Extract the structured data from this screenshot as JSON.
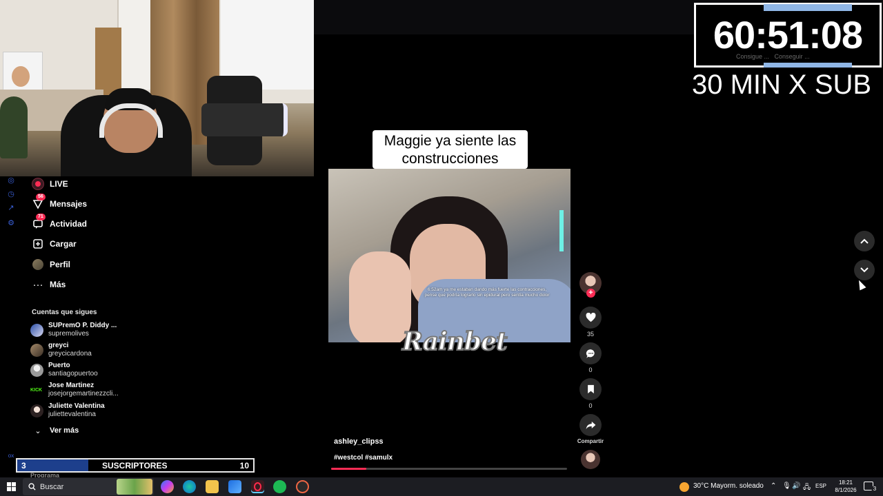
{
  "timer": {
    "value": "60:51:08",
    "ghost_left": "Consigue ...",
    "ghost_right": "Conseguir ...",
    "rate": "30 MIN X SUB"
  },
  "sidebar": {
    "items": [
      {
        "label": "LIVE",
        "icon": "live-icon"
      },
      {
        "label": "Mensajes",
        "icon": "messages-icon",
        "badge": "56"
      },
      {
        "label": "Actividad",
        "icon": "activity-icon",
        "badge": "71"
      },
      {
        "label": "Cargar",
        "icon": "upload-icon"
      },
      {
        "label": "Perfil",
        "icon": "profile-avatar"
      },
      {
        "label": "Más",
        "icon": "more-icon"
      }
    ],
    "following_title": "Cuentas que sigues",
    "following": [
      {
        "name": "SUPremO P. Diddy ...",
        "handle": "supremolives"
      },
      {
        "name": "greyci",
        "handle": "greycicardona"
      },
      {
        "name": "Puerto",
        "handle": "santiagopuertoo"
      },
      {
        "name": "Jose Martinez",
        "handle": "josejorgemartinezzcli...",
        "platform": "KICK"
      },
      {
        "name": "Juliette Valentina",
        "handle": "juliettevalentina"
      }
    ],
    "see_more": "Ver más"
  },
  "subbar": {
    "current": "3",
    "label": "SUSCRIPTORES",
    "goal": "10",
    "under_text": "Programa"
  },
  "video": {
    "caption_line1": "Maggie ya siente las",
    "caption_line2": "construcciones",
    "subtitle_line1": "6:52am ya me estaban dando más fuerte las contracciones,",
    "subtitle_line2": "pense que podría lograrlo sin epidural pero sentía mucho dolor",
    "watermark": "Rainbet",
    "author": "ashley_clipss",
    "tags": "#westcol #samulx",
    "progress": 0.15
  },
  "actions": {
    "likes": "35",
    "comments": "0",
    "saves": "0",
    "share_label": "Compartir"
  },
  "taskbar": {
    "search_label": "Buscar",
    "weather": "30°C  Mayorm. soleado",
    "lang": "ESP",
    "time": "18:21",
    "date": "8/1/2026",
    "notifications": "3"
  },
  "colors": {
    "accent": "#fe2c55",
    "sub_fill": "#1d3f8c",
    "timer_bar": "#8fb6e6"
  }
}
